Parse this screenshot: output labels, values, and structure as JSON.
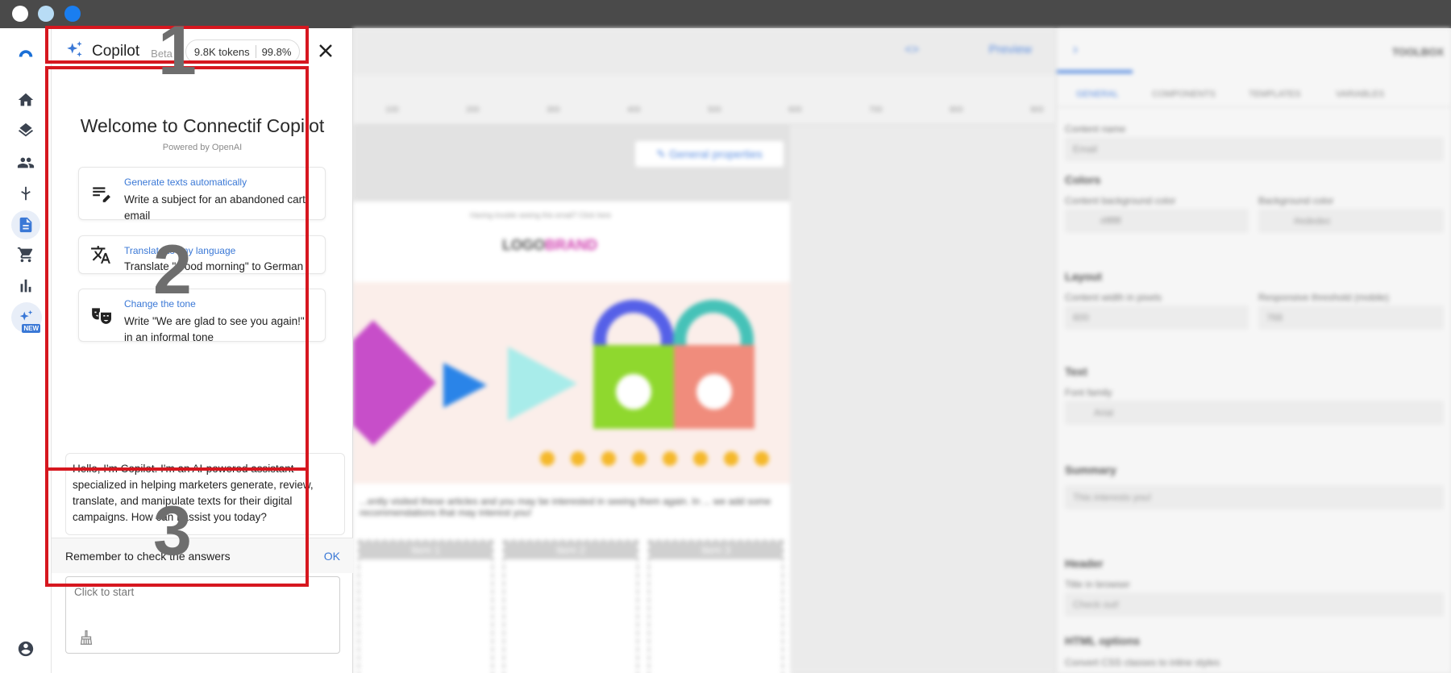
{
  "copilot": {
    "title": "Copilot",
    "beta": "Beta",
    "tokens": "9.8K tokens",
    "percent": "99.8%",
    "welcome_title": "Welcome to Connectif Copilot",
    "powered_by": "Powered by OpenAI",
    "suggestions": [
      {
        "tag": "Generate texts automatically",
        "text": "Write a subject for an abandoned cart email",
        "icon": "text-edit-icon"
      },
      {
        "tag": "Translate to any language",
        "text": "Translate \"Good morning\" to German",
        "icon": "translate-icon"
      },
      {
        "tag": "Change the tone",
        "text": "Write \"We are glad to see you again!\" in an informal tone",
        "icon": "theater-masks-icon"
      }
    ],
    "intro_message": "Hello, I'm Copilot. I'm an AI-powered assistant specialized in helping marketers generate, review, translate, and manipulate texts for their digital campaigns. How can I assist you today?",
    "reminder": "Remember to check the answers",
    "ok_label": "OK",
    "prompt_placeholder": "Click to start"
  },
  "annotations": [
    "1",
    "2",
    "3"
  ],
  "annotation_color": "#d6171f",
  "accent_color": "#3a78d6",
  "editor": {
    "preview_label": "Preview",
    "general_properties": "General properties",
    "trouble_text": "Having trouble seeing this email? Click here",
    "logo_a": "LOGO",
    "logo_b": "BRAND",
    "paragraph": "...ently visited these articles and you may be interested in seeing them again. In ... we add some recommendations that may interest you!",
    "items": [
      "Item 1",
      "Item 2",
      "Item 3"
    ],
    "ruler": [
      "100",
      "200",
      "300",
      "400",
      "500",
      "600",
      "700",
      "800",
      "900"
    ]
  },
  "toolbox": {
    "title": "TOOLBOX",
    "tabs": [
      "GENERAL",
      "COMPONENTS",
      "TEMPLATES",
      "VARIABLES"
    ],
    "content_name_label": "Content name",
    "content_name_value": "Email",
    "colors_title": "Colors",
    "content_bg_label": "Content background color",
    "content_bg_value": "#ffffff",
    "bg_label": "Background color",
    "bg_value": "#ededec",
    "layout_title": "Layout",
    "width_label": "Content width in pixels",
    "width_value": "600",
    "threshold_label": "Responsive threshold (mobile)",
    "threshold_value": "768",
    "text_title": "Text",
    "font_label": "Font family",
    "font_value": "Arial",
    "summary_title": "Summary",
    "summary_value": "This interests you!",
    "header_title": "Header",
    "title_browser_label": "Title in browser",
    "title_browser_value": "Check out!",
    "html_title": "HTML options",
    "css_label": "Convert CSS classes to inline styles"
  }
}
